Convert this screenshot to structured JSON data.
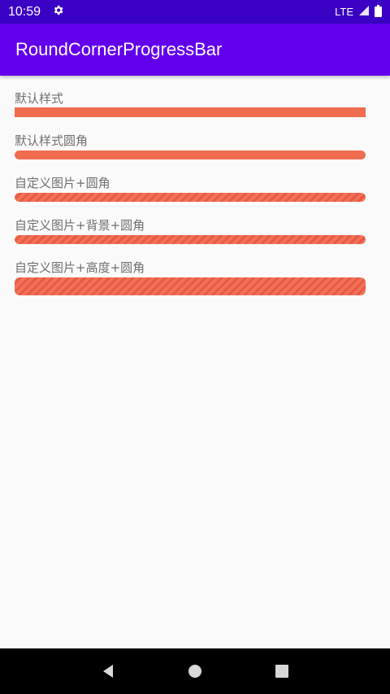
{
  "status": {
    "time": "10:59",
    "network": "LTE"
  },
  "app": {
    "title": "RoundCornerProgressBar"
  },
  "items": [
    {
      "label": "默认样式",
      "progress": 1.0
    },
    {
      "label": "默认样式圆角",
      "progress": 1.0
    },
    {
      "label": "自定义图片+圆角",
      "progress": 1.0
    },
    {
      "label": "自定义图片+背景+圆角",
      "progress": 1.0
    },
    {
      "label": "自定义图片+高度+圆角",
      "progress": 1.0
    }
  ],
  "colors": {
    "status_bar": "#3a00c4",
    "app_bar": "#6200ee",
    "progress": "#ef6c4f"
  }
}
